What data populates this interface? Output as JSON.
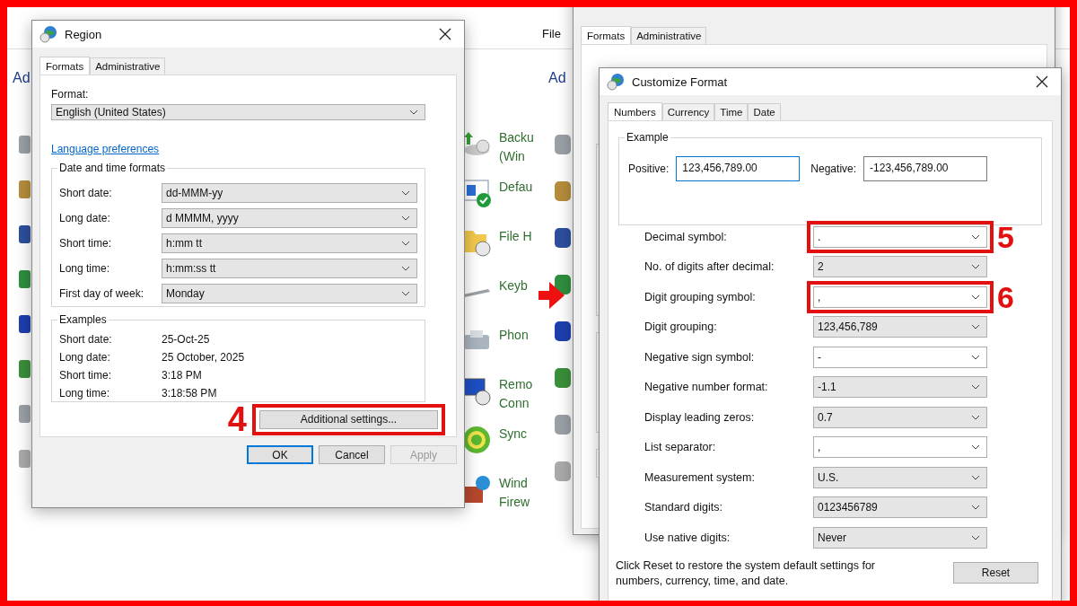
{
  "left_panel": {
    "heading": "Ad",
    "items": [
      {
        "lines": [
          "Backu",
          "(Win"
        ]
      },
      {
        "lines": [
          "Defau"
        ]
      },
      {
        "lines": [
          "File H"
        ]
      },
      {
        "lines": [
          "Keyb"
        ]
      },
      {
        "lines": [
          "Phon"
        ]
      },
      {
        "lines": [
          "Remo",
          "Conn"
        ]
      },
      {
        "lines": [
          "Sync"
        ]
      },
      {
        "lines": [
          "Wind",
          "Firew"
        ]
      }
    ]
  },
  "region_dialog": {
    "title": "Region",
    "tabs": [
      {
        "label": "Formats",
        "selected": true
      },
      {
        "label": "Administrative",
        "selected": false
      }
    ],
    "format_label": "Format:",
    "format_value": "English (United States)",
    "language_link": "Language preferences",
    "date_time": {
      "title": "Date and time formats",
      "rows": [
        {
          "label": "Short date:",
          "value": "dd-MMM-yy"
        },
        {
          "label": "Long date:",
          "value": "d MMMM, yyyy"
        },
        {
          "label": "Short time:",
          "value": "h:mm tt"
        },
        {
          "label": "Long time:",
          "value": "h:mm:ss tt"
        },
        {
          "label": "First day of week:",
          "value": "Monday"
        }
      ]
    },
    "examples": {
      "title": "Examples",
      "rows": [
        {
          "label": "Short date:",
          "value": "25-Oct-25"
        },
        {
          "label": "Long date:",
          "value": "25 October, 2025"
        },
        {
          "label": "Short time:",
          "value": "3:18 PM"
        },
        {
          "label": "Long time:",
          "value": "3:18:58 PM"
        }
      ]
    },
    "additional_button": {
      "label": "Additional settings...",
      "callout": "4"
    },
    "buttons": [
      {
        "label": "OK",
        "default": true,
        "disabled": false
      },
      {
        "label": "Cancel",
        "default": false,
        "disabled": false
      },
      {
        "label": "Apply",
        "default": false,
        "disabled": true
      }
    ]
  },
  "background_window": {
    "menu": "File",
    "heading": "Ad",
    "tabs": [
      {
        "label": "Formats",
        "selected": true
      },
      {
        "label": "Administrative",
        "selected": false
      }
    ]
  },
  "customize_dialog": {
    "title": "Customize Format",
    "tabs": [
      {
        "label": "Numbers",
        "selected": true
      },
      {
        "label": "Currency",
        "selected": false
      },
      {
        "label": "Time",
        "selected": false
      },
      {
        "label": "Date",
        "selected": false
      }
    ],
    "example": {
      "title": "Example",
      "positive_label": "Positive:",
      "positive_value": "123,456,789.00",
      "negative_label": "Negative:",
      "negative_value": "-123,456,789.00"
    },
    "rows": [
      {
        "label": "Decimal symbol:",
        "value": ".",
        "callout": "5"
      },
      {
        "label": "No. of digits after decimal:",
        "value": "2"
      },
      {
        "label": "Digit grouping symbol:",
        "value": ",",
        "callout": "6"
      },
      {
        "label": "Digit grouping:",
        "value": "123,456,789"
      },
      {
        "label": "Negative sign symbol:",
        "value": "-"
      },
      {
        "label": "Negative number format:",
        "value": "-1.1"
      },
      {
        "label": "Display leading zeros:",
        "value": "0.7"
      },
      {
        "label": "List separator:",
        "value": ","
      },
      {
        "label": "Measurement system:",
        "value": "U.S."
      },
      {
        "label": "Standard digits:",
        "value": "0123456789"
      },
      {
        "label": "Use native digits:",
        "value": "Never"
      }
    ],
    "note": "Click Reset to restore the system default settings for numbers, currency, time, and date.",
    "reset_button": "Reset"
  }
}
